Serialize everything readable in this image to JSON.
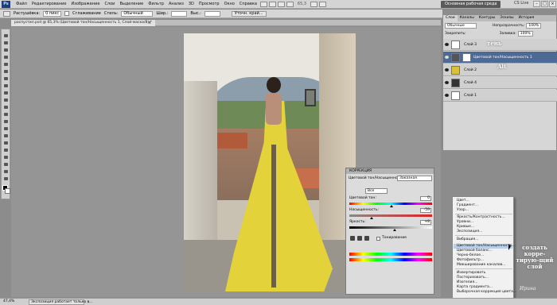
{
  "app_logo": "Ps",
  "menu": [
    "Файл",
    "Редактирование",
    "Изображение",
    "Слои",
    "Выделение",
    "Фильтр",
    "Анализ",
    "3D",
    "Просмотр",
    "Окно",
    "Справка"
  ],
  "zoom": "65,3",
  "workspace_button": "Основная рабочая среда",
  "cs_live": "CS Live",
  "window_controls": [
    "–",
    "□",
    "×"
  ],
  "options": {
    "feather_label": "Растушёвка:",
    "feather_value": "0 пикс",
    "antialias_label": "Сглаживание",
    "style_label": "Стиль:",
    "style_value": "Обычный",
    "width_label": "Шир.:",
    "height_label": "Выс.:",
    "refine_button": "Уточн. край..."
  },
  "document": {
    "tab_title": "распустил.psd @ 65,3% (Цветовой тон/Насыщенность 1, Слой-маска/8) *",
    "close": "×"
  },
  "adjustments": {
    "header": "КОРРЕКЦИЯ",
    "title": "Цветовой тон/Насыщенность",
    "preset": "Заказная",
    "edit": "Все",
    "hue_label": "Цветовой тон:",
    "hue_value": "0",
    "saturation_label": "Насыщенность:",
    "saturation_value": "-59",
    "lightness_label": "Яркость:",
    "lightness_value": "+8",
    "colorize_label": "Тонирование"
  },
  "layers": {
    "tabs": [
      "Слои",
      "Каналы",
      "Контуры",
      "Эскизы",
      "История"
    ],
    "blend_mode": "Обычные",
    "opacity_label": "Непрозрачность:",
    "opacity_value": "100%",
    "lock_label": "Закрепить:",
    "fill_label": "Заливка:",
    "fill_value": "100%",
    "items": [
      {
        "name": "Слой 3"
      },
      {
        "name": "Цветовой тон/Насыщенность 1"
      },
      {
        "name": "Слой 2"
      },
      {
        "name": "Слой 4"
      },
      {
        "name": "Слой 1"
      }
    ],
    "annotation_shadow": "тень",
    "annotation_alt": "Alt"
  },
  "dropdown_menu": {
    "items": [
      "Цвет...",
      "Градиент...",
      "Узор...",
      "Яркость/Контрастность...",
      "Уровни...",
      "Кривые...",
      "Экспозиция...",
      "Вибрация...",
      "Цветовой тон/Насыщенность...",
      "Цветовой баланс...",
      "Черно-белое...",
      "Фотофильтр...",
      "Микширование каналов...",
      "Инвертировать",
      "Постеризовать...",
      "Изогелия...",
      "Карта градиента...",
      "Выборочная коррекция цвета..."
    ],
    "highlighted": "Цветовой тон/Насыщенность..."
  },
  "annotation_create": "создать корре-тирую-щий слой",
  "watermark": "Ирина",
  "taskbar": {
    "start": "47,4%",
    "task1": "Экспозиция работает только в..."
  }
}
